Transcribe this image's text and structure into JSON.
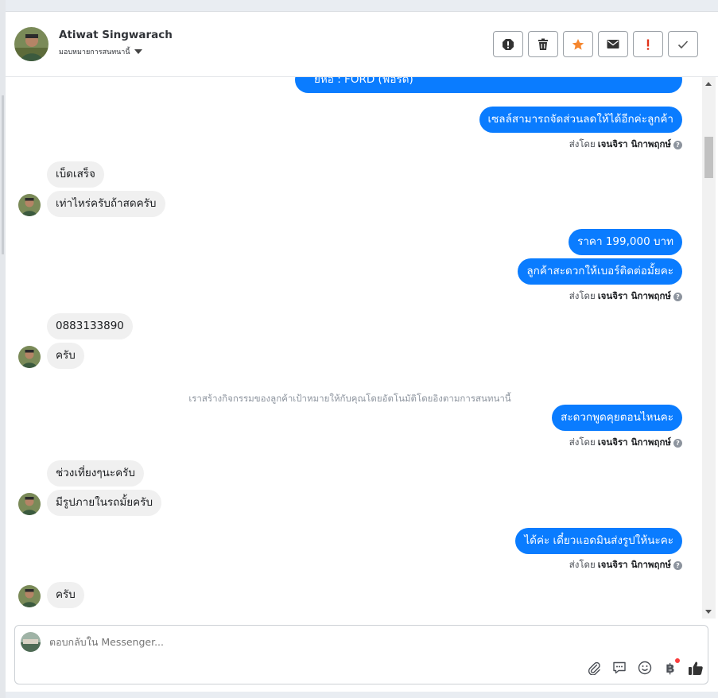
{
  "header": {
    "user_name": "Atiwat Singwarach",
    "assign_label": "มอบหมายการสนทนานี้",
    "actions": [
      {
        "name": "spam-icon",
        "label": "!"
      },
      {
        "name": "trash-icon",
        "label": ""
      },
      {
        "name": "star-icon",
        "label": ""
      },
      {
        "name": "mail-icon",
        "label": ""
      },
      {
        "name": "important-icon",
        "label": "!"
      },
      {
        "name": "check-icon",
        "label": ""
      }
    ]
  },
  "messages": {
    "m0": "ยี่ห้อ : FORD (ฟอร์ด)",
    "m1": "เซลล์สามารถจัดส่วนลดให้ได้อีกค่ะลูกค้า",
    "m2": "เบ็ดเสร็จ",
    "m3": "เท่าไหร่ครับถ้าสดครับ",
    "m4": "ราคา 199,000 บาท",
    "m5": "ลูกค้าสะดวกให้เบอร์ติดต่อมั้ยคะ",
    "m6": "0883133890",
    "m7": "ครับ",
    "m8": "สะดวกพูดคุยตอนไหนคะ",
    "m9": "ช่วงเที่ยงๆนะครับ",
    "m10": "มีรูปภายในรถมั้ยครับ",
    "m11": "ได้ค่ะ เดี๋ยวแอดมินส่งรูปให้นะคะ",
    "m12": "ครับ"
  },
  "sent_by": {
    "prefix": "ส่งโดย",
    "agent": "เจนจิรา นิกาพฤกษ์",
    "help": "?"
  },
  "system_note": "เราสร้างกิจกรรมของลูกค้าเป้าหมายให้กับคุณโดยอัตโนมัติโดยอิงตามการสนทนานี้",
  "composer": {
    "placeholder": "ตอบกลับใน Messenger...",
    "tools": [
      "attach-icon",
      "reply-template-icon",
      "emoji-icon",
      "payment-icon",
      "like-icon"
    ],
    "payment_label": "฿"
  },
  "colors": {
    "outgoing": "#0a7cff",
    "incoming": "#f0f0f0",
    "star": "#f5862e",
    "important": "#e0321a"
  }
}
